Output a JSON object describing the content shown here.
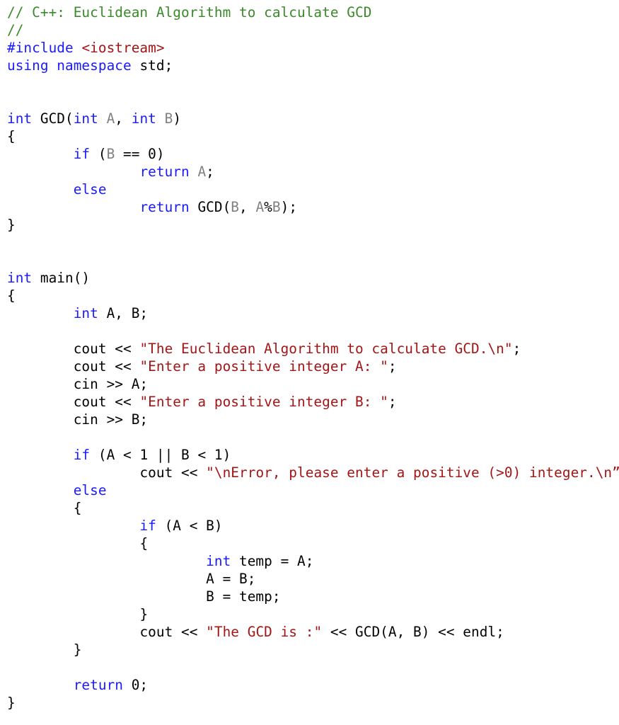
{
  "document": {
    "language": "C++",
    "colors": {
      "comment": "#3a8a2a",
      "keyword": "#1a1aff",
      "string": "#a31515",
      "parameter": "#808080",
      "plain": "#000000",
      "background": "#ffffff"
    },
    "lines": [
      [
        {
          "t": "comment",
          "v": "// C++: Euclidean Algorithm to calculate GCD"
        }
      ],
      [
        {
          "t": "comment",
          "v": "//"
        }
      ],
      [
        {
          "t": "keyword",
          "v": "#include "
        },
        {
          "t": "string",
          "v": "<iostream>"
        }
      ],
      [
        {
          "t": "keyword",
          "v": "using namespace "
        },
        {
          "t": "plain",
          "v": "std;"
        }
      ],
      [],
      [],
      [
        {
          "t": "keyword",
          "v": "int "
        },
        {
          "t": "plain",
          "v": "GCD("
        },
        {
          "t": "keyword",
          "v": "int "
        },
        {
          "t": "param",
          "v": "A"
        },
        {
          "t": "plain",
          "v": ", "
        },
        {
          "t": "keyword",
          "v": "int "
        },
        {
          "t": "param",
          "v": "B"
        },
        {
          "t": "plain",
          "v": ")"
        }
      ],
      [
        {
          "t": "plain",
          "v": "{"
        }
      ],
      [
        {
          "t": "plain",
          "v": "\t"
        },
        {
          "t": "keyword",
          "v": "if "
        },
        {
          "t": "plain",
          "v": "("
        },
        {
          "t": "param",
          "v": "B"
        },
        {
          "t": "plain",
          "v": " == 0)"
        }
      ],
      [
        {
          "t": "plain",
          "v": "\t\t"
        },
        {
          "t": "keyword",
          "v": "return "
        },
        {
          "t": "param",
          "v": "A"
        },
        {
          "t": "plain",
          "v": ";"
        }
      ],
      [
        {
          "t": "plain",
          "v": "\t"
        },
        {
          "t": "keyword",
          "v": "else"
        }
      ],
      [
        {
          "t": "plain",
          "v": "\t\t"
        },
        {
          "t": "keyword",
          "v": "return "
        },
        {
          "t": "plain",
          "v": "GCD("
        },
        {
          "t": "param",
          "v": "B"
        },
        {
          "t": "plain",
          "v": ", "
        },
        {
          "t": "param",
          "v": "A"
        },
        {
          "t": "plain",
          "v": "%"
        },
        {
          "t": "param",
          "v": "B"
        },
        {
          "t": "plain",
          "v": ");"
        }
      ],
      [
        {
          "t": "plain",
          "v": "}"
        }
      ],
      [],
      [],
      [
        {
          "t": "keyword",
          "v": "int "
        },
        {
          "t": "plain",
          "v": "main()"
        }
      ],
      [
        {
          "t": "plain",
          "v": "{"
        }
      ],
      [
        {
          "t": "plain",
          "v": "\t"
        },
        {
          "t": "keyword",
          "v": "int "
        },
        {
          "t": "plain",
          "v": "A, B;"
        }
      ],
      [],
      [
        {
          "t": "plain",
          "v": "\tcout << "
        },
        {
          "t": "string",
          "v": "\"The Euclidean Algorithm to calculate GCD.\\n\""
        },
        {
          "t": "plain",
          "v": ";"
        }
      ],
      [
        {
          "t": "plain",
          "v": "\tcout << "
        },
        {
          "t": "string",
          "v": "\"Enter a positive integer A: \""
        },
        {
          "t": "plain",
          "v": ";"
        }
      ],
      [
        {
          "t": "plain",
          "v": "\tcin >> A;"
        }
      ],
      [
        {
          "t": "plain",
          "v": "\tcout << "
        },
        {
          "t": "string",
          "v": "\"Enter a positive integer B: \""
        },
        {
          "t": "plain",
          "v": ";"
        }
      ],
      [
        {
          "t": "plain",
          "v": "\tcin >> B;"
        }
      ],
      [],
      [
        {
          "t": "plain",
          "v": "\t"
        },
        {
          "t": "keyword",
          "v": "if "
        },
        {
          "t": "plain",
          "v": "(A < 1 || B < 1)"
        }
      ],
      [
        {
          "t": "plain",
          "v": "\t\tcout << "
        },
        {
          "t": "string",
          "v": "\"\\nError, please enter a positive (>0) integer.\\n”"
        },
        {
          "t": "plain",
          "v": ";"
        }
      ],
      [
        {
          "t": "plain",
          "v": "\t"
        },
        {
          "t": "keyword",
          "v": "else"
        }
      ],
      [
        {
          "t": "plain",
          "v": "\t{"
        }
      ],
      [
        {
          "t": "plain",
          "v": "\t\t"
        },
        {
          "t": "keyword",
          "v": "if "
        },
        {
          "t": "plain",
          "v": "(A < B)"
        }
      ],
      [
        {
          "t": "plain",
          "v": "\t\t{"
        }
      ],
      [
        {
          "t": "plain",
          "v": "\t\t\t"
        },
        {
          "t": "keyword",
          "v": "int "
        },
        {
          "t": "plain",
          "v": "temp = A;"
        }
      ],
      [
        {
          "t": "plain",
          "v": "\t\t\tA = B;"
        }
      ],
      [
        {
          "t": "plain",
          "v": "\t\t\tB = temp;"
        }
      ],
      [
        {
          "t": "plain",
          "v": "\t\t}"
        }
      ],
      [
        {
          "t": "plain",
          "v": "\t\tcout << "
        },
        {
          "t": "string",
          "v": "\"The GCD is :\""
        },
        {
          "t": "plain",
          "v": " << GCD(A, B) << endl;"
        }
      ],
      [
        {
          "t": "plain",
          "v": "\t}"
        }
      ],
      [],
      [
        {
          "t": "plain",
          "v": "\t"
        },
        {
          "t": "keyword",
          "v": "return "
        },
        {
          "t": "plain",
          "v": "0;"
        }
      ],
      [
        {
          "t": "plain",
          "v": "}"
        }
      ]
    ]
  }
}
